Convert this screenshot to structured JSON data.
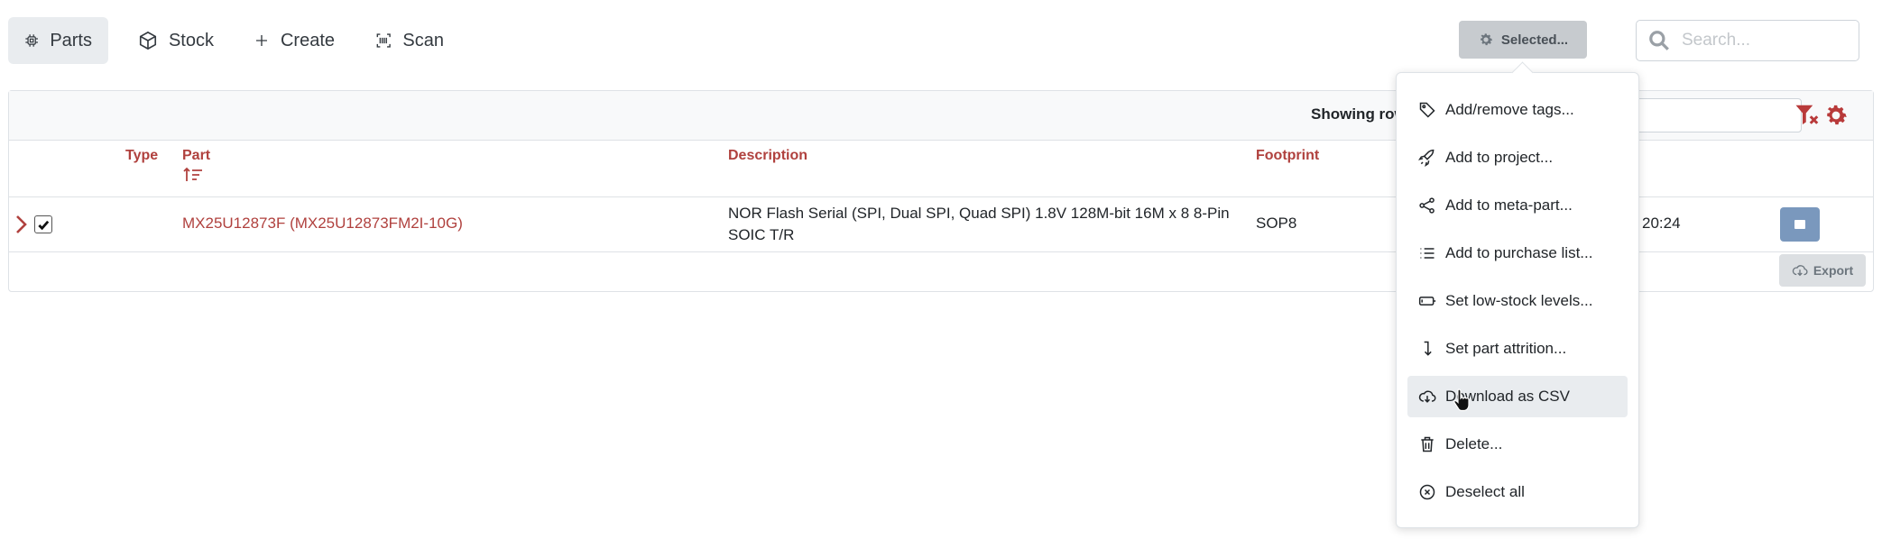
{
  "nav": {
    "items": [
      {
        "label": "Parts",
        "icon": "chip-icon",
        "active": true
      },
      {
        "label": "Stock",
        "icon": "box-icon",
        "active": false
      },
      {
        "label": "Create",
        "icon": "plus-icon",
        "active": false
      },
      {
        "label": "Scan",
        "icon": "barcode-icon",
        "active": false
      }
    ],
    "selected_button": "Selected...",
    "search_placeholder": "Search..."
  },
  "table": {
    "showing_text": "Showing rows",
    "columns": {
      "type": "Type",
      "part": "Part",
      "description": "Description",
      "footprint": "Footprint"
    },
    "row": {
      "checked": true,
      "part": "MX25U12873F (MX25U12873FM2I-10G)",
      "description": "NOR Flash Serial (SPI, Dual SPI, Quad SPI) 1.8V 128M-bit 16M x 8 8-Pin SOIC T/R",
      "footprint": "SOP8",
      "time": "20:24"
    },
    "export_label": "Export"
  },
  "menu": {
    "items": [
      {
        "label": "Add/remove tags...",
        "icon": "tag-icon"
      },
      {
        "label": "Add to project...",
        "icon": "rocket-icon"
      },
      {
        "label": "Add to meta-part...",
        "icon": "share-icon"
      },
      {
        "label": "Add to purchase list...",
        "icon": "list-icon"
      },
      {
        "label": "Set low-stock levels...",
        "icon": "battery-low-icon"
      },
      {
        "label": "Set part attrition...",
        "icon": "arrow-down-icon"
      },
      {
        "label": "Download as CSV",
        "icon": "cloud-download-icon"
      },
      {
        "label": "Delete...",
        "icon": "trash-icon"
      },
      {
        "label": "Deselect all",
        "icon": "circle-x-icon"
      }
    ],
    "hovered": "Download as CSV"
  },
  "colors": {
    "accent_red": "#b0413e",
    "row_button": "#7a98bd"
  }
}
